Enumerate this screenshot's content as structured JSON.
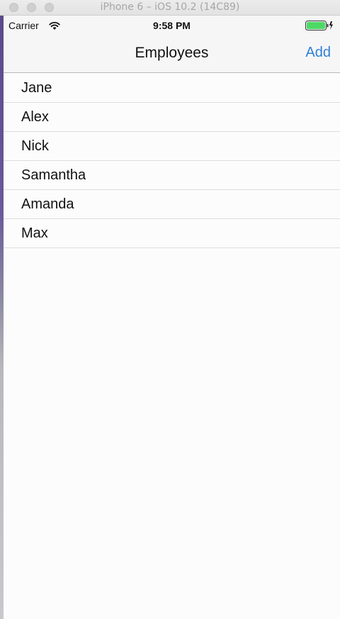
{
  "window": {
    "title": "iPhone 6 – iOS 10.2 (14C89)"
  },
  "status_bar": {
    "carrier": "Carrier",
    "time": "9:58 PM",
    "wifi_icon": "wifi-icon",
    "battery_icon": "battery-icon",
    "battery_color": "#4cd964"
  },
  "nav_bar": {
    "title": "Employees",
    "add_label": "Add",
    "accent_color": "#2f7fd6"
  },
  "employees": [
    {
      "name": "Jane"
    },
    {
      "name": "Alex"
    },
    {
      "name": "Nick"
    },
    {
      "name": "Samantha"
    },
    {
      "name": "Amanda"
    },
    {
      "name": "Max"
    }
  ]
}
